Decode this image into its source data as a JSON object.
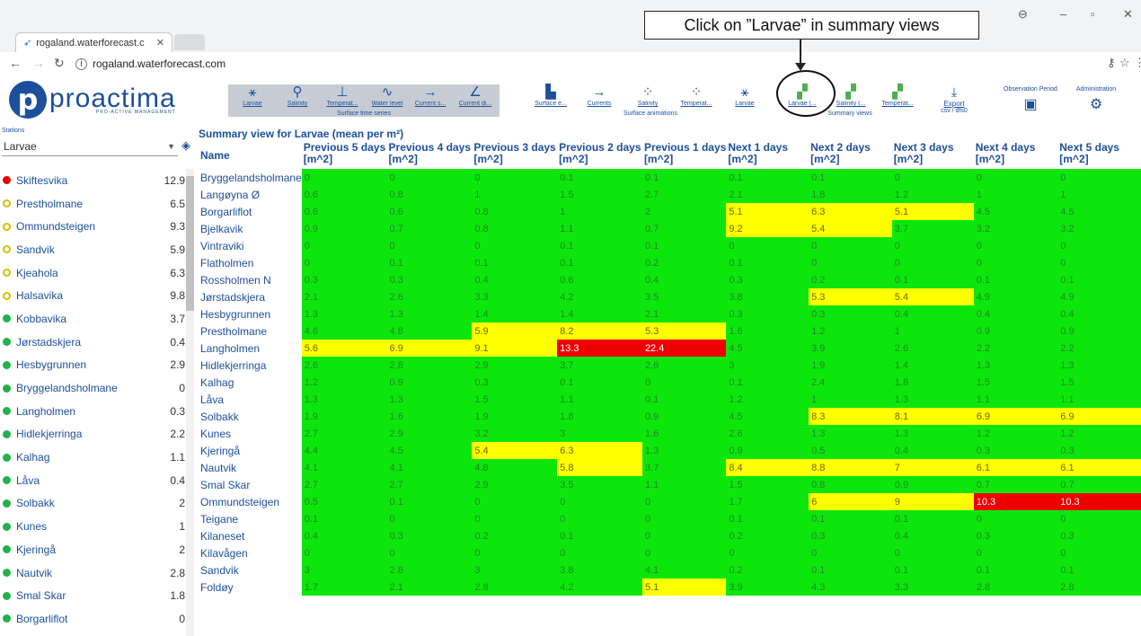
{
  "browser": {
    "tab_title": "rogaland.waterforecast.c",
    "url": "rogaland.waterforecast.com"
  },
  "callout": {
    "text": "Click on ”Larvae” in summary views"
  },
  "logo": {
    "name": "proactima",
    "tagline": "PRO-ACTIVE MANAGEMENT"
  },
  "toolbar": {
    "time_series": {
      "group_label": "Surface time series",
      "buttons": [
        {
          "label": "Larvae",
          "icon": "bug-icon",
          "glyph": "⚹"
        },
        {
          "label": "Salinity",
          "icon": "pin-icon",
          "glyph": "⚲"
        },
        {
          "label": "Temperat...",
          "icon": "thermometer-icon",
          "glyph": "⊥"
        },
        {
          "label": "Water level",
          "icon": "wave-icon",
          "glyph": "∿"
        },
        {
          "label": "Current s...",
          "icon": "arrow-right-icon",
          "glyph": "→"
        },
        {
          "label": "Current di...",
          "icon": "angle-icon",
          "glyph": "∠"
        }
      ]
    },
    "animations": {
      "group_label": "Surface animations",
      "buttons": [
        {
          "label": "Surface e...",
          "icon": "chart-icon",
          "glyph": "▙"
        },
        {
          "label": "Currents",
          "icon": "arrow-right-icon",
          "glyph": "→"
        },
        {
          "label": "Salinity",
          "icon": "drops-icon",
          "glyph": "⁘"
        },
        {
          "label": "Temperat...",
          "icon": "drops-icon",
          "glyph": "⁘"
        },
        {
          "label": "Larvae",
          "icon": "bug-icon",
          "glyph": "⚹"
        }
      ]
    },
    "summary": {
      "group_label": "Summary views",
      "buttons": [
        {
          "label": "Larvae (...",
          "icon": "map-icon",
          "glyph": "▞"
        },
        {
          "label": "Salinity (...",
          "icon": "map-icon",
          "glyph": "▞"
        },
        {
          "label": "Temperat...",
          "icon": "map-icon",
          "glyph": "▞"
        }
      ]
    },
    "export": {
      "label": "Export",
      "sub": "csv / dfs0",
      "icon": "download-icon",
      "glyph": "⤓"
    },
    "observation_period": {
      "label": "Observation Period",
      "icon": "calendar-icon",
      "glyph": "▣"
    },
    "administration": {
      "label": "Administration",
      "icon": "gear-icon",
      "glyph": "⚙"
    }
  },
  "sidebar": {
    "title": "Stations",
    "select_value": "Larvae",
    "stations": [
      {
        "name": "Skiftesvika",
        "value": "12.9",
        "status": "red"
      },
      {
        "name": "Prestholmane",
        "value": "6.5",
        "status": "yellow"
      },
      {
        "name": "Ommundsteigen",
        "value": "9.3",
        "status": "yellow"
      },
      {
        "name": "Sandvik",
        "value": "5.9",
        "status": "yellow"
      },
      {
        "name": "Kjeahola",
        "value": "6.3",
        "status": "yellow"
      },
      {
        "name": "Halsavika",
        "value": "9.8",
        "status": "yellow"
      },
      {
        "name": "Kobbavika",
        "value": "3.7",
        "status": "green"
      },
      {
        "name": "Jørstadskjera",
        "value": "0.4",
        "status": "green"
      },
      {
        "name": "Hesbygrunnen",
        "value": "2.9",
        "status": "green"
      },
      {
        "name": "Bryggelandsholmane",
        "value": "0",
        "status": "green"
      },
      {
        "name": "Langholmen",
        "value": "0.3",
        "status": "green"
      },
      {
        "name": "Hidlekjerringa",
        "value": "2.2",
        "status": "green"
      },
      {
        "name": "Kalhag",
        "value": "1.1",
        "status": "green"
      },
      {
        "name": "Låva",
        "value": "0.4",
        "status": "green"
      },
      {
        "name": "Solbakk",
        "value": "2",
        "status": "green"
      },
      {
        "name": "Kunes",
        "value": "1",
        "status": "green"
      },
      {
        "name": "Kjeringå",
        "value": "2",
        "status": "green"
      },
      {
        "name": "Nautvik",
        "value": "2.8",
        "status": "green"
      },
      {
        "name": "Smal Skar",
        "value": "1.8",
        "status": "green"
      },
      {
        "name": "Borgarliflot",
        "value": "0",
        "status": "green"
      }
    ]
  },
  "summary": {
    "title": "Summary view for Larvae (mean per m²)",
    "columns": [
      {
        "l1": "Name",
        "l2": ""
      },
      {
        "l1": "Previous 5 days",
        "l2": "[m^2]"
      },
      {
        "l1": "Previous 4 days",
        "l2": "[m^2]"
      },
      {
        "l1": "Previous 3 days",
        "l2": "[m^2]"
      },
      {
        "l1": "Previous 2 days",
        "l2": "[m^2]"
      },
      {
        "l1": "Previous 1 days",
        "l2": "[m^2]"
      },
      {
        "l1": "Next 1 days",
        "l2": "[m^2]"
      },
      {
        "l1": "Next 2 days",
        "l2": "[m^2]"
      },
      {
        "l1": "Next 3 days",
        "l2": "[m^2]"
      },
      {
        "l1": "Next 4 days",
        "l2": "[m^2]"
      },
      {
        "l1": "Next 5 days",
        "l2": "[m^2]"
      }
    ],
    "rows": [
      {
        "name": "Bryggelandsholmane",
        "values": [
          "0",
          "0",
          "0",
          "0.1",
          "0.1",
          "0.1",
          "0.1",
          "0",
          "0",
          "0"
        ]
      },
      {
        "name": "Langøyna Ø",
        "values": [
          "0.6",
          "0.8",
          "1",
          "1.5",
          "2.7",
          "2.1",
          "1.8",
          "1.2",
          "1",
          "1"
        ]
      },
      {
        "name": "Borgarliflot",
        "values": [
          "0.6",
          "0.6",
          "0.8",
          "1",
          "2",
          "5.1",
          "6.3",
          "5.1",
          "4.5",
          "4.5"
        ]
      },
      {
        "name": "Bjelkavik",
        "values": [
          "0.9",
          "0.7",
          "0.8",
          "1.1",
          "0.7",
          "9.2",
          "5.4",
          "3.7",
          "3.2",
          "3.2"
        ]
      },
      {
        "name": "Vintraviki",
        "values": [
          "0",
          "0",
          "0",
          "0.1",
          "0.1",
          "0",
          "0",
          "0",
          "0",
          "0"
        ]
      },
      {
        "name": "Flatholmen",
        "values": [
          "0",
          "0.1",
          "0.1",
          "0.1",
          "0.2",
          "0.1",
          "0",
          "0",
          "0",
          "0"
        ]
      },
      {
        "name": "Rossholmen N",
        "values": [
          "0.3",
          "0.3",
          "0.4",
          "0.6",
          "0.4",
          "0.3",
          "0.2",
          "0.1",
          "0.1",
          "0.1"
        ]
      },
      {
        "name": "Jørstadskjera",
        "values": [
          "2.1",
          "2.6",
          "3.3",
          "4.2",
          "3.5",
          "3.8",
          "5.3",
          "5.4",
          "4.9",
          "4.9"
        ]
      },
      {
        "name": "Hesbygrunnen",
        "values": [
          "1.3",
          "1.3",
          "1.4",
          "1.4",
          "2.1",
          "0.3",
          "0.3",
          "0.4",
          "0.4",
          "0.4"
        ]
      },
      {
        "name": "Prestholmane",
        "values": [
          "4.6",
          "4.8",
          "5.9",
          "8.2",
          "5.3",
          "1.6",
          "1.2",
          "1",
          "0.9",
          "0.9"
        ]
      },
      {
        "name": "Langholmen",
        "values": [
          "5.6",
          "6.9",
          "9.1",
          "13.3",
          "22.4",
          "4.5",
          "3.9",
          "2.6",
          "2.2",
          "2.2"
        ]
      },
      {
        "name": "Hidlekjerringa",
        "values": [
          "2.6",
          "2.8",
          "2.9",
          "3.7",
          "2.6",
          "3",
          "1.9",
          "1.4",
          "1.3",
          "1.3"
        ]
      },
      {
        "name": "Kalhag",
        "values": [
          "1.2",
          "0.9",
          "0.3",
          "0.1",
          "0",
          "0.1",
          "2.4",
          "1.8",
          "1.5",
          "1.5"
        ]
      },
      {
        "name": "Låva",
        "values": [
          "1.3",
          "1.3",
          "1.5",
          "1.1",
          "0.1",
          "1.2",
          "1",
          "1.3",
          "1.1",
          "1.1"
        ]
      },
      {
        "name": "Solbakk",
        "values": [
          "1.9",
          "1.6",
          "1.9",
          "1.8",
          "0.9",
          "4.5",
          "8.3",
          "8.1",
          "6.9",
          "6.9"
        ]
      },
      {
        "name": "Kunes",
        "values": [
          "2.7",
          "2.9",
          "3.2",
          "3",
          "1.6",
          "2.6",
          "1.3",
          "1.3",
          "1.2",
          "1.2"
        ]
      },
      {
        "name": "Kjeringå",
        "values": [
          "4.4",
          "4.5",
          "5.4",
          "6.3",
          "1.3",
          "0.9",
          "0.5",
          "0.4",
          "0.3",
          "0.3"
        ]
      },
      {
        "name": "Nautvik",
        "values": [
          "4.1",
          "4.1",
          "4.8",
          "5.8",
          "3.7",
          "8.4",
          "8.8",
          "7",
          "6.1",
          "6.1"
        ]
      },
      {
        "name": "Smal Skar",
        "values": [
          "2.7",
          "2.7",
          "2.9",
          "3.5",
          "1.1",
          "1.5",
          "0.8",
          "0.9",
          "0.7",
          "0.7"
        ]
      },
      {
        "name": "Ommundsteigen",
        "values": [
          "0.5",
          "0.1",
          "0",
          "0",
          "0",
          "1.7",
          "6",
          "9",
          "10.3",
          "10.3"
        ]
      },
      {
        "name": "Teigane",
        "values": [
          "0.1",
          "0",
          "0",
          "0",
          "0",
          "0.1",
          "0.1",
          "0.1",
          "0",
          "0"
        ]
      },
      {
        "name": "Kilaneset",
        "values": [
          "0.4",
          "0.3",
          "0.2",
          "0.1",
          "0",
          "0.2",
          "0.3",
          "0.4",
          "0.3",
          "0.3"
        ]
      },
      {
        "name": "Kilavågen",
        "values": [
          "0",
          "0",
          "0",
          "0",
          "0",
          "0",
          "0",
          "0",
          "0",
          "0"
        ]
      },
      {
        "name": "Sandvik",
        "values": [
          "3",
          "2.8",
          "3",
          "3.8",
          "4.1",
          "0.2",
          "0.1",
          "0.1",
          "0.1",
          "0.1"
        ]
      },
      {
        "name": "Foldøy",
        "values": [
          "1.7",
          "2.1",
          "2.8",
          "4.2",
          "5.1",
          "3.9",
          "4.3",
          "3.3",
          "2.8",
          "2.8"
        ]
      }
    ],
    "thresholds": {
      "yellow_min": 5,
      "red_min": 10
    },
    "colors": {
      "green": "#0de60d",
      "yellow": "#ffff00",
      "red": "#ee0000"
    }
  }
}
